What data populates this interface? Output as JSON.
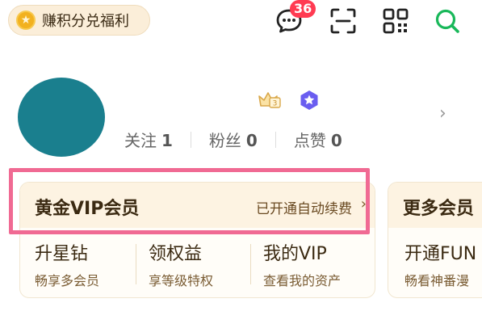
{
  "topbar": {
    "points_label": "赚积分兑福利",
    "message_badge": "36",
    "icons": [
      "message-icon",
      "scan-icon",
      "qr-code-icon",
      "search-icon"
    ]
  },
  "profile": {
    "stats": [
      {
        "label": "关注",
        "value": "1"
      },
      {
        "label": "粉丝",
        "value": "0"
      },
      {
        "label": "点赞",
        "value": "0"
      }
    ],
    "badges": [
      "crown-level-icon",
      "star-badge-icon"
    ]
  },
  "vip_card": {
    "title": "黄金VIP会员",
    "status": "已开通自动续费",
    "items": [
      {
        "title": "升星钻",
        "subtitle": "畅享多会员"
      },
      {
        "title": "领权益",
        "subtitle": "享等级特权"
      },
      {
        "title": "我的VIP",
        "subtitle": "查看我的资产"
      }
    ]
  },
  "more_card": {
    "title": "更多会员",
    "item_title": "开通FUN",
    "item_subtitle": "畅看神番漫"
  },
  "colors": {
    "accent_green": "#19b85a",
    "badge_red": "#ff3b52",
    "highlight_pink": "#f06a93",
    "avatar_teal": "#1a7f8e",
    "card_header": "#fdf3e2"
  }
}
